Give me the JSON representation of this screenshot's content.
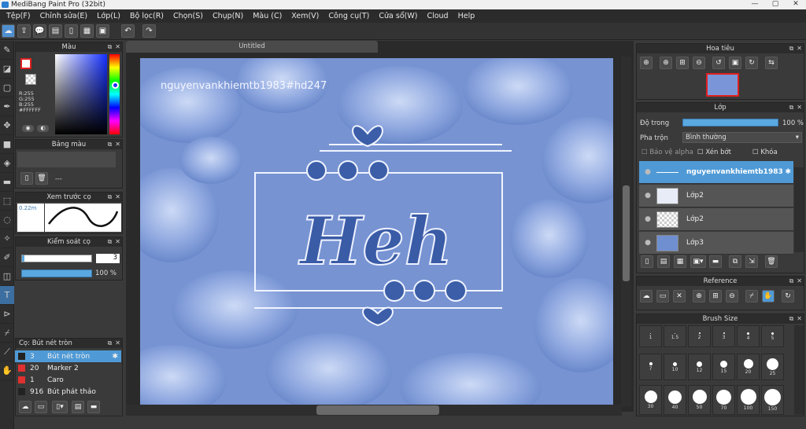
{
  "title": "MediBang Paint Pro (32bit)",
  "menu": [
    "Tệp(F)",
    "Chỉnh sửa(E)",
    "Lớp(L)",
    "Bộ lọc(R)",
    "Chọn(S)",
    "Chụp(N)",
    "Màu (C)",
    "Xem(V)",
    "Công cụ(T)",
    "Cửa sổ(W)",
    "Cloud",
    "Help"
  ],
  "document": {
    "tab": "Untitled",
    "watermark": "nguyenvankhiemtb1983#hd247"
  },
  "color_panel": {
    "title": "Màu",
    "r": "R:255",
    "g": "G:255",
    "b": "B:255",
    "hex": "#FFFFFF",
    "primary": "#ffffff",
    "accent": "#e02020"
  },
  "palette_panel": {
    "title": "Bảng màu",
    "entry": "---"
  },
  "brush_preview": {
    "title": "Xem trước cọ",
    "size": "0.22m"
  },
  "brush_control": {
    "title": "Kiểm soát cọ",
    "size_value": "3",
    "opacity_value": "100 %",
    "opacity_pct": 100
  },
  "brush_list": {
    "title": "Cọ: Bút nét tròn",
    "items": [
      {
        "size": "3",
        "name": "Bút nét tròn",
        "color": "#222222"
      },
      {
        "size": "20",
        "name": "Marker 2",
        "color": "#e03030"
      },
      {
        "size": "1",
        "name": "Caro",
        "color": "#e03030"
      },
      {
        "size": "916",
        "name": "Bút phát thảo",
        "color": "#222222"
      }
    ]
  },
  "navigator": {
    "title": "Hoa tiêu"
  },
  "layer_panel": {
    "title": "Lớp",
    "opacity_label": "Độ trong",
    "opacity_value": "100 %",
    "opacity_pct": 100,
    "blend_label": "Pha trộn",
    "blend_value": "Bình thường",
    "protect_alpha": "Bảo vệ alpha",
    "clipping": "Xén bớt",
    "lock": "Khóa",
    "layers": [
      {
        "name": "nguyenvankhiemtb1983",
        "selected": true
      },
      {
        "name": "Lớp2",
        "selected": false
      },
      {
        "name": "Lớp2",
        "selected": false
      },
      {
        "name": "Lớp3",
        "selected": false
      }
    ]
  },
  "reference_panel": {
    "title": "Reference"
  },
  "brush_size_panel": {
    "title": "Brush Size",
    "rows": [
      [
        "1",
        "1.5",
        "2",
        "3",
        "4",
        "5"
      ],
      [
        "7",
        "10",
        "12",
        "15",
        "20",
        "25"
      ],
      [
        "30",
        "40",
        "50",
        "70",
        "100",
        "150"
      ]
    ]
  }
}
